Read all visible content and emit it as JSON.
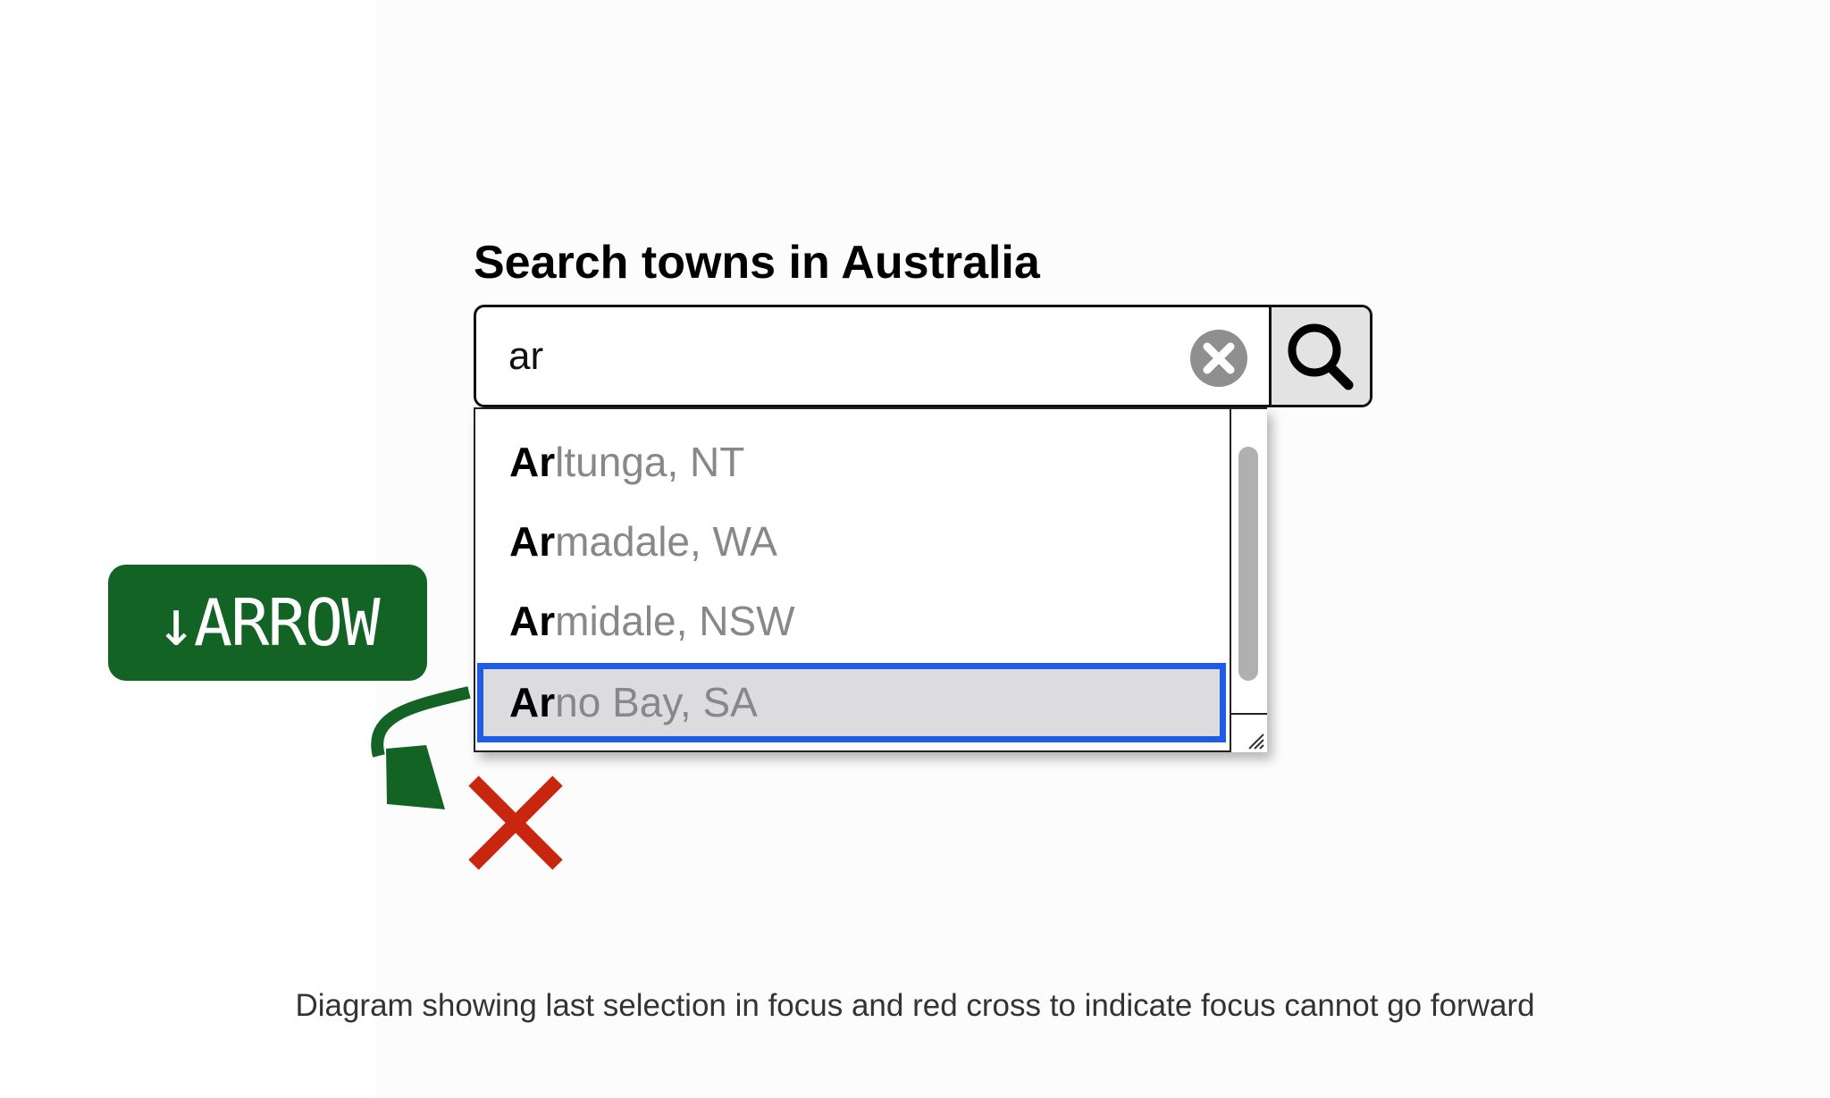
{
  "search": {
    "label": "Search towns in Australia",
    "query": "ar",
    "clear_icon": "clear-circle-x-icon",
    "search_icon": "magnifier-icon"
  },
  "suggestions": [
    {
      "match": "Ar",
      "rest": "ltunga, NT",
      "focused": false
    },
    {
      "match": "Ar",
      "rest": "madale, WA",
      "focused": false
    },
    {
      "match": "Ar",
      "rest": "midale, NSW",
      "focused": false
    },
    {
      "match": "Ar",
      "rest": "no Bay, SA",
      "focused": true
    }
  ],
  "key_hint": {
    "arrow": "↓",
    "label": "ARROW",
    "color": "#136325"
  },
  "colors": {
    "focus_ring": "#1e5be6",
    "blocked_cross": "#c8260f",
    "focused_row_bg": "#dcdcdf"
  },
  "caption": "Diagram showing last selection in focus and red cross to indicate focus cannot go forward"
}
